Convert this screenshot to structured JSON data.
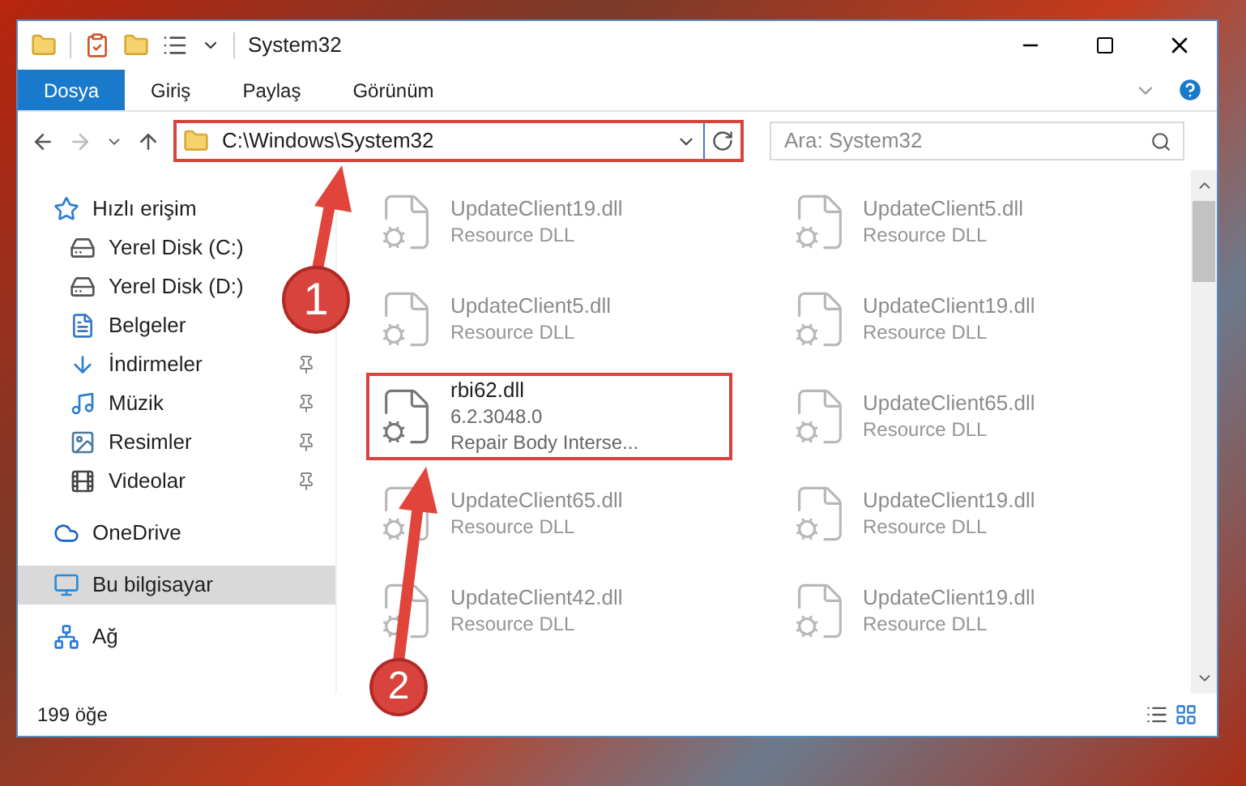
{
  "window": {
    "title": "System32"
  },
  "ribbon_tabs": [
    {
      "label": "Dosya",
      "selected": true
    },
    {
      "label": "Giriş",
      "selected": false
    },
    {
      "label": "Paylaş",
      "selected": false
    },
    {
      "label": "Görünüm",
      "selected": false
    }
  ],
  "address": {
    "path": "C:\\Windows\\System32",
    "highlighted": true
  },
  "search": {
    "placeholder": "Ara: System32"
  },
  "sidebar": {
    "items": [
      {
        "label": "Hızlı erişim",
        "kind": "star",
        "selected": false,
        "children": [
          {
            "label": "Yerel Disk (C:)",
            "kind": "drive",
            "pinned": false
          },
          {
            "label": "Yerel Disk (D:)",
            "kind": "drive",
            "pinned": false
          },
          {
            "label": "Belgeler",
            "kind": "documents",
            "pinned": false
          },
          {
            "label": "İndirmeler",
            "kind": "downloads",
            "pinned": true
          },
          {
            "label": "Müzik",
            "kind": "music",
            "pinned": true
          },
          {
            "label": "Resimler",
            "kind": "pictures",
            "pinned": true
          },
          {
            "label": "Videolar",
            "kind": "videos",
            "pinned": true
          }
        ]
      },
      {
        "label": "OneDrive",
        "kind": "cloud",
        "selected": false
      },
      {
        "label": "Bu bilgisayar",
        "kind": "computer",
        "selected": true
      },
      {
        "label": "Ağ",
        "kind": "network",
        "selected": false
      }
    ]
  },
  "files": [
    {
      "name": "UpdateClient19.dll",
      "lines": [
        "Resource DLL"
      ],
      "dimmed": true,
      "highlighted": false
    },
    {
      "name": "UpdateClient5.dll",
      "lines": [
        "Resource DLL"
      ],
      "dimmed": true,
      "highlighted": false
    },
    {
      "name": "UpdateClient5.dll",
      "lines": [
        "Resource DLL"
      ],
      "dimmed": true,
      "highlighted": false
    },
    {
      "name": "UpdateClient19.dll",
      "lines": [
        "Resource DLL"
      ],
      "dimmed": true,
      "highlighted": false
    },
    {
      "name": "rbi62.dll",
      "lines": [
        "6.2.3048.0",
        "Repair Body Interse..."
      ],
      "dimmed": false,
      "highlighted": true
    },
    {
      "name": "UpdateClient65.dll",
      "lines": [
        "Resource DLL"
      ],
      "dimmed": true,
      "highlighted": false
    },
    {
      "name": "UpdateClient65.dll",
      "lines": [
        "Resource DLL"
      ],
      "dimmed": true,
      "highlighted": false
    },
    {
      "name": "UpdateClient19.dll",
      "lines": [
        "Resource DLL"
      ],
      "dimmed": true,
      "highlighted": false
    },
    {
      "name": "UpdateClient42.dll",
      "lines": [
        "Resource DLL"
      ],
      "dimmed": true,
      "highlighted": false
    },
    {
      "name": "UpdateClient19.dll",
      "lines": [
        "Resource DLL"
      ],
      "dimmed": true,
      "highlighted": false
    }
  ],
  "status_bar": {
    "count": "199 öğe"
  },
  "annotations": [
    {
      "number": "1"
    },
    {
      "number": "2"
    }
  ]
}
